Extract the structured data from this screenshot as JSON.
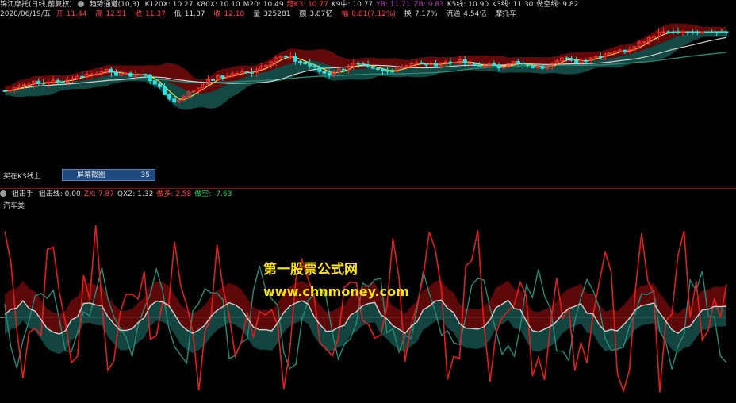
{
  "header": {
    "stock_name": "锦江摩托(日线,前复权)",
    "indicator_name": "趋势通道(10,3)",
    "top_values": [
      {
        "label": "K120X:",
        "value": "10.27",
        "color": "w"
      },
      {
        "label": "K80X:",
        "value": "10.10",
        "color": "w"
      },
      {
        "label": "M20:",
        "value": "10.49",
        "color": "w"
      },
      {
        "label": "趋K3:",
        "value": "10.77",
        "color": "r"
      },
      {
        "label": "K9中:",
        "value": "10.77",
        "color": "w"
      },
      {
        "label": "YB:",
        "value": "11.71",
        "color": "m"
      },
      {
        "label": "ZB:",
        "value": "9.83",
        "color": "m"
      },
      {
        "label": "K5线:",
        "value": "10.90",
        "color": "w"
      },
      {
        "label": "K3线:",
        "value": "11.30",
        "color": "w"
      },
      {
        "label": "做空线:",
        "value": "9.82",
        "color": "w"
      }
    ]
  },
  "quote": {
    "date": "2020/06/19/五",
    "open_label": "开",
    "open": "11.44",
    "high_label": "高",
    "high": "12.51",
    "close_label": "收",
    "close": "11.37",
    "low_label": "低",
    "low": "11.37",
    "prev_label": "收",
    "prev": "12.18",
    "volume_label": "量",
    "volume": "325281",
    "amount_label": "额",
    "amount": "3.87亿",
    "change_label": "幅",
    "change": "0.81(7.12%)",
    "turnover_label": "换",
    "turnover": "7.17%",
    "float_label": "流通",
    "float": "4.54亿",
    "sector": "摩托车"
  },
  "main_panel": {
    "buy_label": "买在K3线上",
    "screenshot_label": "屏幕截图",
    "screenshot_value": "35"
  },
  "sub_panel": {
    "indicator_name": "狙击手",
    "values": [
      {
        "label": "狙击线:",
        "value": "0.00",
        "color": "w"
      },
      {
        "label": "ZX:",
        "value": "7.87",
        "color": "r"
      },
      {
        "label": "QXZ:",
        "value": "1.32",
        "color": "w"
      },
      {
        "label": "做多:",
        "value": "2.58",
        "color": "r"
      },
      {
        "label": "做空:",
        "value": "-7.63",
        "color": "g"
      }
    ],
    "sector_name": "汽车类"
  },
  "watermark": {
    "title": "第一股票公式网",
    "url": "www.chnmoney.com"
  },
  "colors": {
    "up": "#ff3030",
    "down": "#30e0e0",
    "channel_red": "#6e0a0a",
    "channel_teal": "#16504a",
    "yellow_line": "#f0e040",
    "white_line": "#d0d0d0",
    "teal_line": "#2a8a78"
  }
}
